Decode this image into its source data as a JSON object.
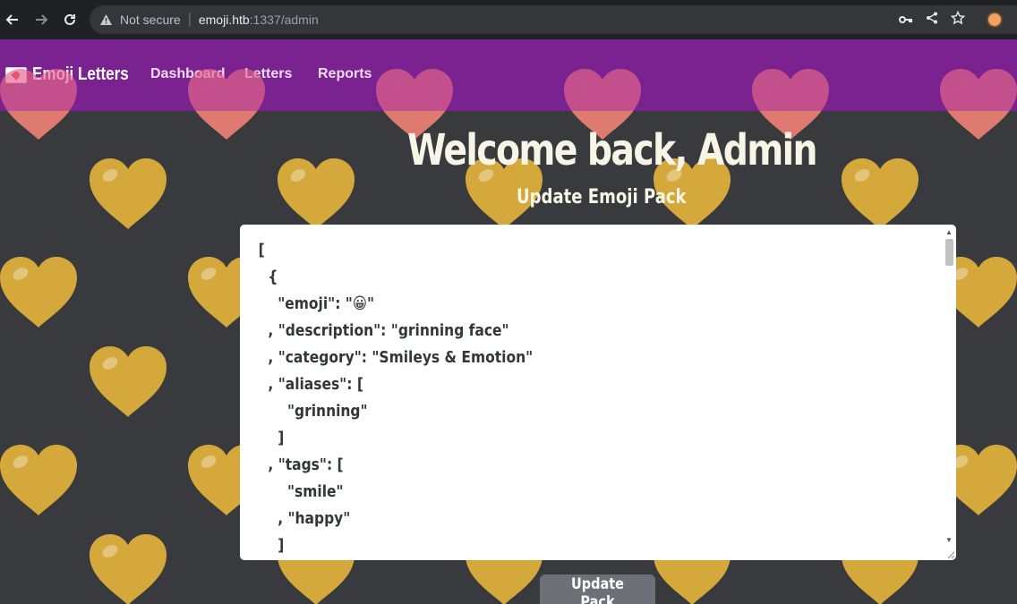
{
  "browser": {
    "security_label": "Not secure",
    "url_host": "emoji.htb",
    "url_rest": ":1337/admin",
    "icons": [
      "back-arrow-icon",
      "forward-arrow-icon",
      "reload-icon",
      "warning-icon",
      "key-icon",
      "share-icon",
      "star-icon",
      "extension-icon"
    ]
  },
  "navbar": {
    "brand": "Emoji Letters",
    "links": [
      "Dashboard",
      "Letters",
      "Reports"
    ],
    "color": "#802196"
  },
  "main": {
    "welcome": "Welcome back, Admin",
    "subtitle": "Update Emoji Pack",
    "editor_content": "[\n  {\n    \"emoji\": \"😀\"\n  , \"description\": \"grinning face\"\n  , \"category\": \"Smileys & Emotion\"\n  , \"aliases\": [\n      \"grinning\"\n    ]\n  , \"tags\": [\n      \"smile\"\n    , \"happy\"\n    ]",
    "button_label": "Update Pack"
  },
  "background": {
    "heart_color": "#d4a83a",
    "heart_color_on_navbar": "#e4638c"
  }
}
